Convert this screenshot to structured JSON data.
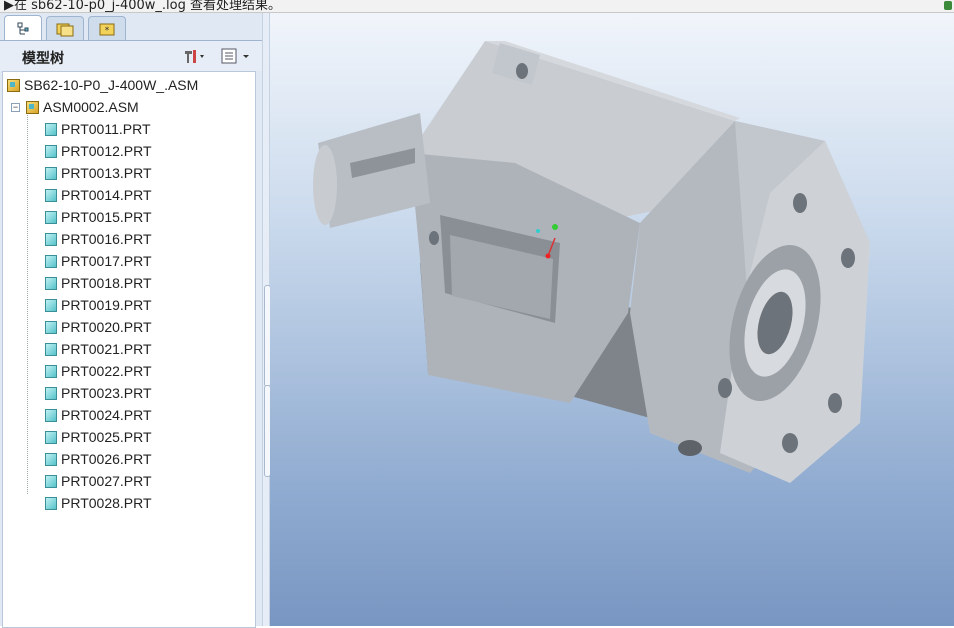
{
  "status_bar": {
    "message": "▶在 sb62-10-p0_j-400w_.log 查看处理结果。"
  },
  "left_panel": {
    "tabs": [
      {
        "name": "model-tree-tab",
        "icon": "model-tree-icon",
        "active": true
      },
      {
        "name": "folder-browser-tab",
        "icon": "folder-icon",
        "active": false
      },
      {
        "name": "favorites-tab",
        "icon": "favorites-icon",
        "active": false
      }
    ],
    "tree_header": {
      "title": "模型树",
      "settings_icon": "tools-icon",
      "show_icon": "list-icon"
    },
    "tree": {
      "root": "SB62-10-P0_J-400W_.ASM",
      "sub_assembly": "ASM0002.ASM",
      "parts": [
        "PRT0011.PRT",
        "PRT0012.PRT",
        "PRT0013.PRT",
        "PRT0014.PRT",
        "PRT0015.PRT",
        "PRT0016.PRT",
        "PRT0017.PRT",
        "PRT0018.PRT",
        "PRT0019.PRT",
        "PRT0020.PRT",
        "PRT0021.PRT",
        "PRT0022.PRT",
        "PRT0023.PRT",
        "PRT0024.PRT",
        "PRT0025.PRT",
        "PRT0026.PRT",
        "PRT0027.PRT",
        "PRT0028.PRT"
      ]
    }
  },
  "viewport": {
    "model_description": "gearbox-3d-model",
    "colors": {
      "bg_top": "#f1f5fb",
      "bg_bottom": "#7896c2",
      "model": "#b9bec5"
    }
  }
}
